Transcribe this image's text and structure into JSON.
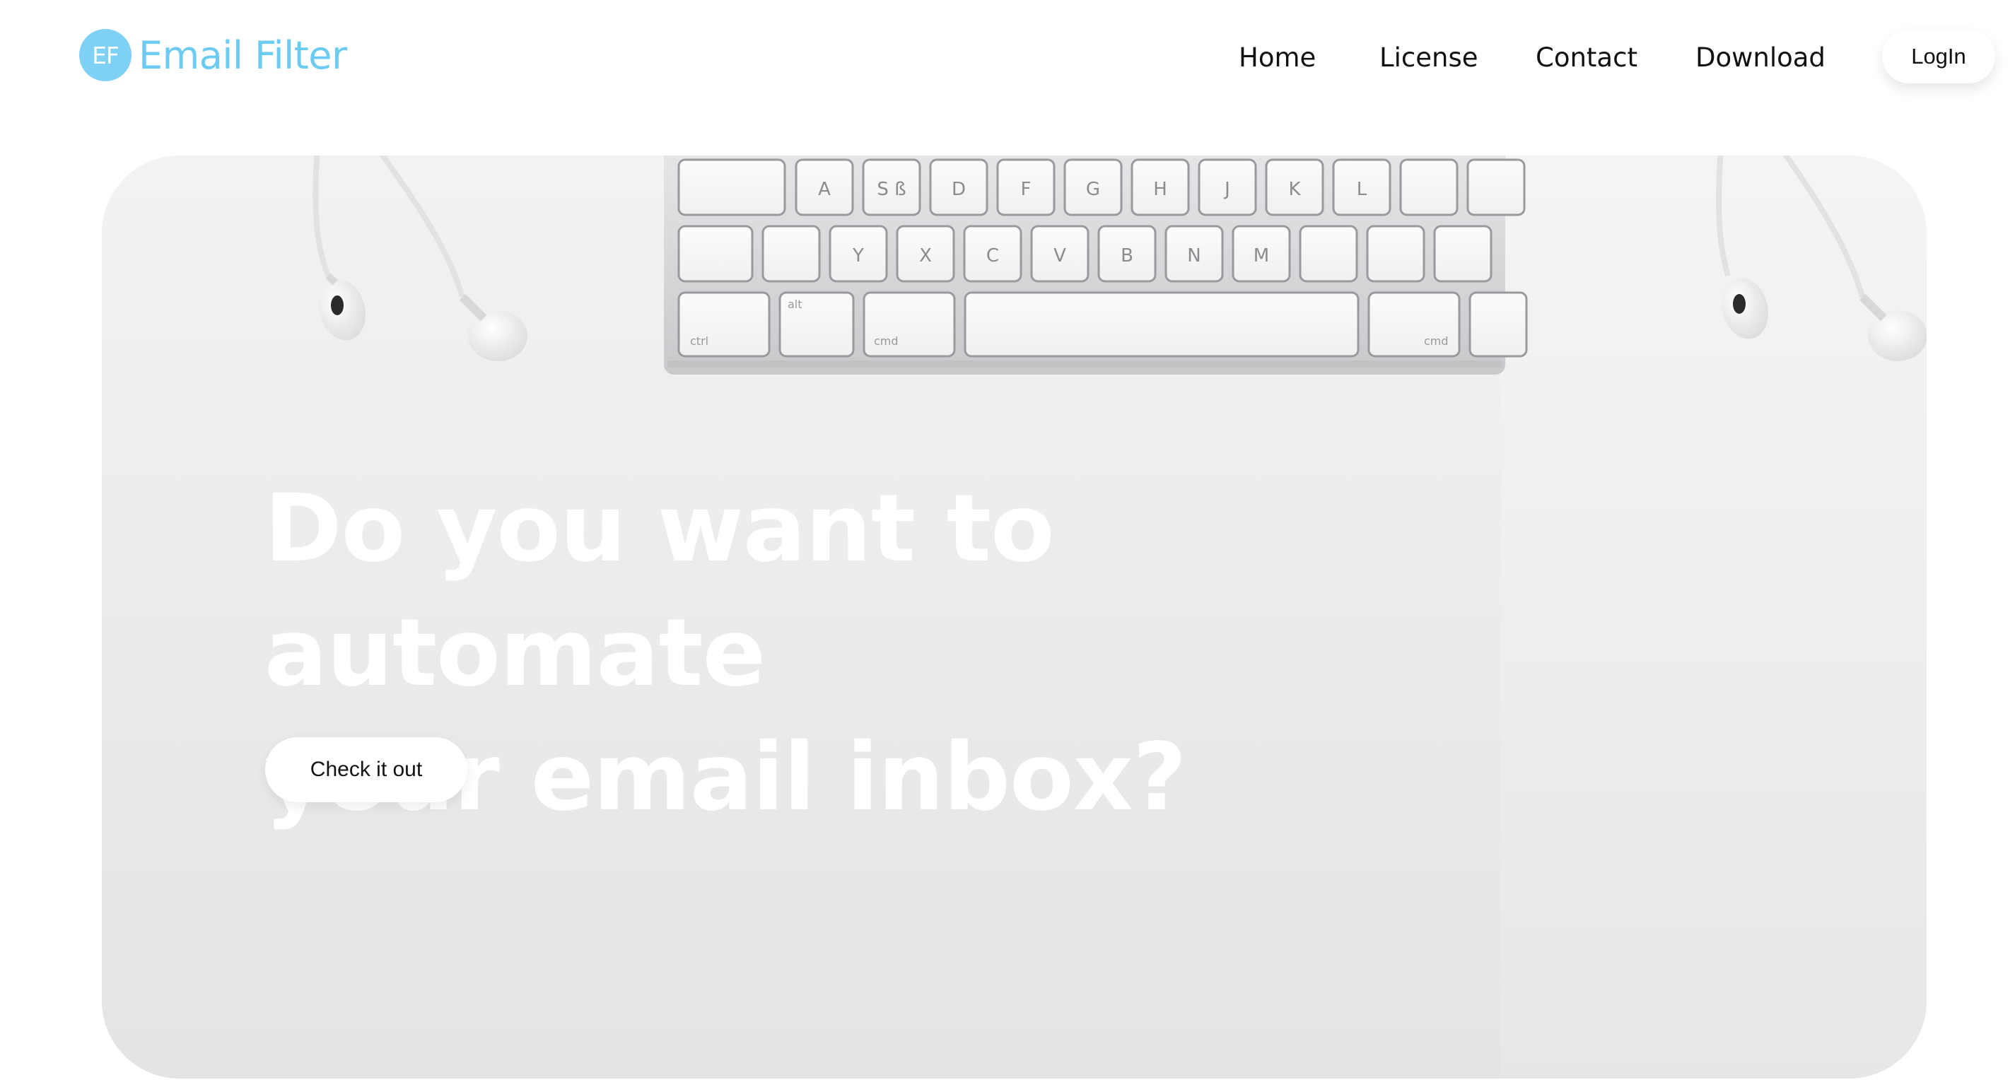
{
  "brand": {
    "badge": "EF",
    "name": "Email Filter",
    "color": "#6ccbf2"
  },
  "nav": {
    "items": [
      {
        "label": "Home"
      },
      {
        "label": "License"
      },
      {
        "label": "Contact"
      },
      {
        "label": "Download"
      }
    ],
    "login_label": "LogIn"
  },
  "hero": {
    "headline_line1": "Do you want to automate",
    "headline_line2": "your email inbox?",
    "cta_label": "Check it out",
    "background_image": "white-keyboard-and-earphones-photo"
  }
}
